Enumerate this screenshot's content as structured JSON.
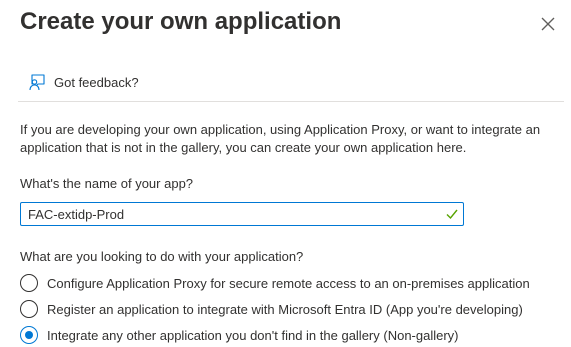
{
  "dialog": {
    "title": "Create your own application",
    "close_icon": "close-icon"
  },
  "feedback": {
    "icon": "feedback-icon",
    "label": "Got feedback?"
  },
  "description": "If you are developing your own application, using Application Proxy, or want to integrate an application that is not in the gallery, you can create your own application here.",
  "app_name": {
    "label": "What's the name of your app?",
    "value": "FAC-extidp-Prod",
    "valid_icon": "checkmark-icon"
  },
  "purpose": {
    "question": "What are you looking to do with your application?",
    "options": [
      {
        "label": "Configure Application Proxy for secure remote access to an on-premises application",
        "selected": false
      },
      {
        "label": "Register an application to integrate with Microsoft Entra ID (App you're developing)",
        "selected": false
      },
      {
        "label": "Integrate any other application you don't find in the gallery (Non-gallery)",
        "selected": true
      }
    ]
  },
  "colors": {
    "accent": "#0078d4",
    "text": "#323130",
    "valid_check": "#57a300",
    "divider": "#e1dfdd"
  }
}
